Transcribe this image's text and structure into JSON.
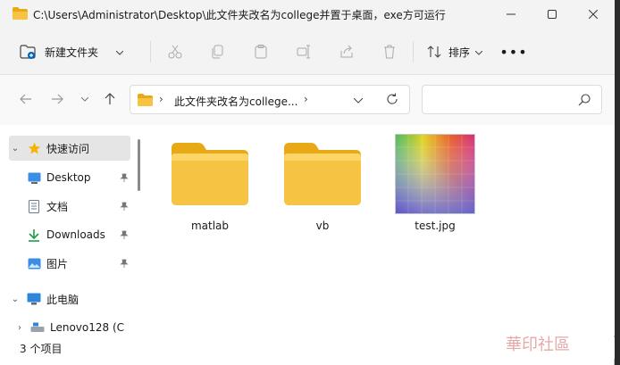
{
  "window": {
    "title": "C:\\Users\\Administrator\\Desktop\\此文件夹改名为college并置于桌面，exe方可运行"
  },
  "commands": {
    "new_folder": "新建文件夹",
    "sort": "排序",
    "more": "•••",
    "icons": [
      "cut-icon",
      "copy-icon",
      "paste-icon",
      "rename-icon",
      "share-icon",
      "delete-icon"
    ]
  },
  "address": {
    "crumb": "此文件夹改名为college...",
    "search_placeholder": ""
  },
  "sidebar": {
    "items": [
      {
        "label": "快速访问",
        "icon": "star-icon",
        "expand": "⌄"
      },
      {
        "label": "Desktop",
        "icon": "desktop-icon",
        "pinned": true
      },
      {
        "label": "文档",
        "icon": "document-icon",
        "pinned": true
      },
      {
        "label": "Downloads",
        "icon": "download-icon",
        "pinned": true
      },
      {
        "label": "图片",
        "icon": "picture-icon",
        "pinned": true
      },
      {
        "label": "此电脑",
        "icon": "computer-icon",
        "expand": "⌄"
      },
      {
        "label": "Lenovo128 (C",
        "icon": "drive-icon",
        "expand": "›"
      }
    ]
  },
  "files": [
    {
      "name": "matlab",
      "type": "folder"
    },
    {
      "name": "vb",
      "type": "folder"
    },
    {
      "name": "test.jpg",
      "type": "image"
    }
  ],
  "status": {
    "count_text": "3 个项目"
  },
  "watermark": "華印社區",
  "colors": {
    "folder": "#f6c342",
    "folder_dark": "#e8a916",
    "accent": "#0067c0"
  }
}
